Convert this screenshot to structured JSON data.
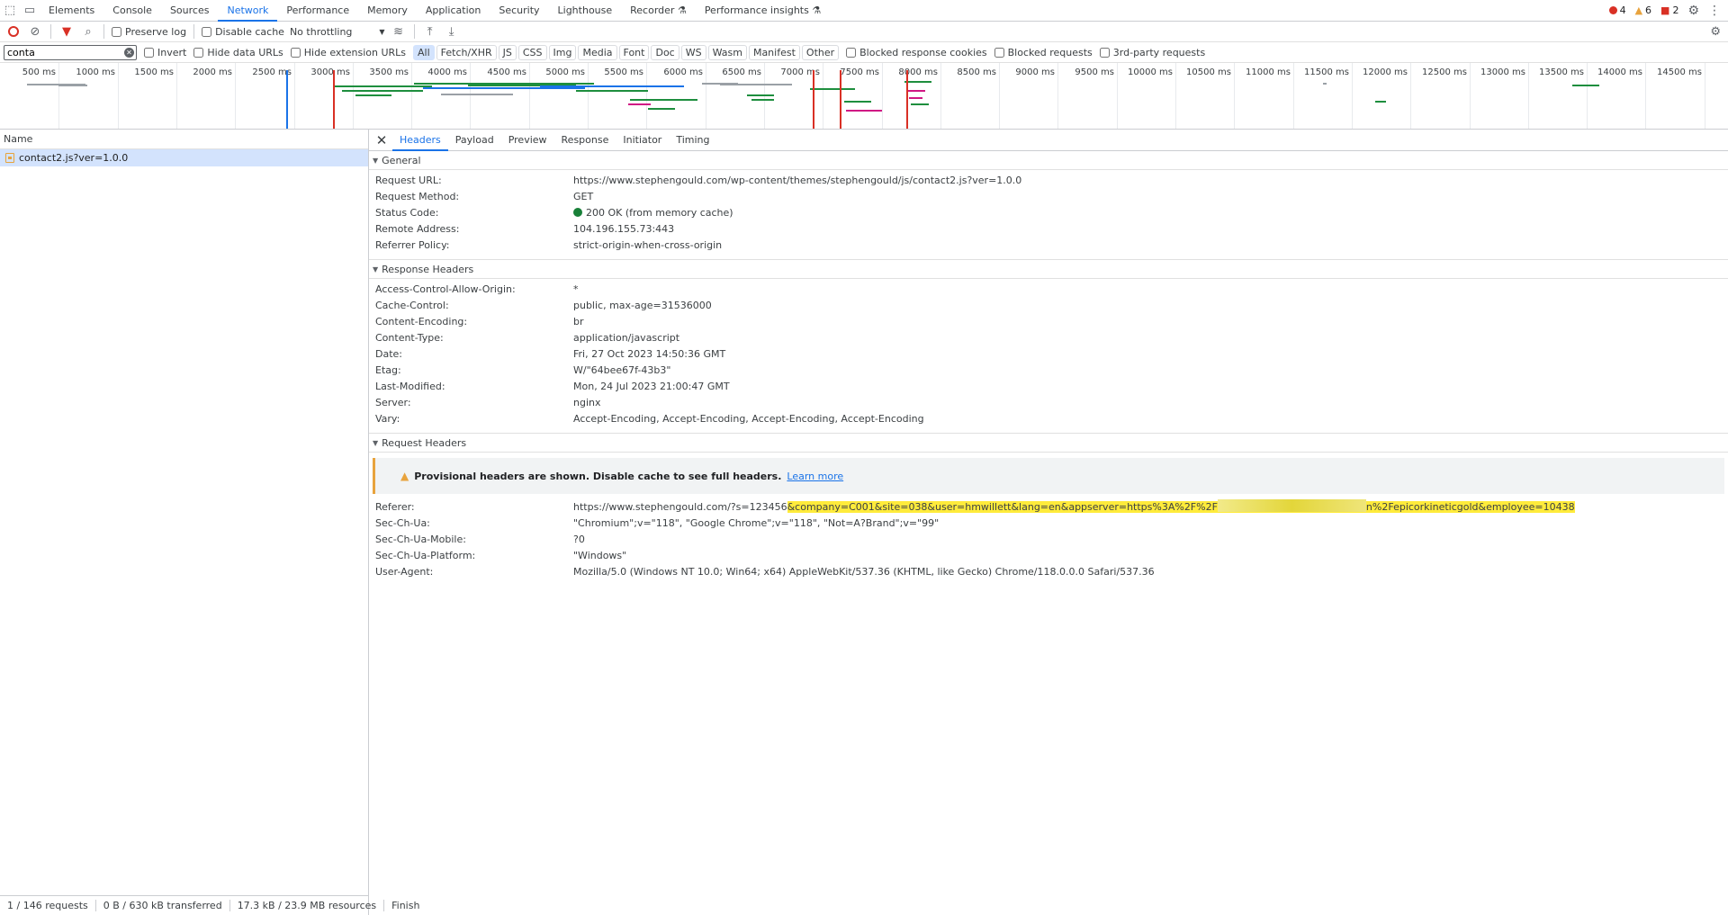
{
  "devtools": {
    "tabs": [
      "Elements",
      "Console",
      "Sources",
      "Network",
      "Performance",
      "Memory",
      "Application",
      "Security",
      "Lighthouse",
      "Recorder",
      "Performance insights"
    ],
    "active_tab": "Network",
    "counts": {
      "errors": "4",
      "warnings": "6",
      "issues": "2"
    }
  },
  "toolbar": {
    "preserve_log": "Preserve log",
    "disable_cache": "Disable cache",
    "throttling": "No throttling"
  },
  "filter": {
    "value": "conta",
    "invert": "Invert",
    "hide_data_urls": "Hide data URLs",
    "hide_extension_urls": "Hide extension URLs",
    "types": [
      "All",
      "Fetch/XHR",
      "JS",
      "CSS",
      "Img",
      "Media",
      "Font",
      "Doc",
      "WS",
      "Wasm",
      "Manifest",
      "Other"
    ],
    "blocked_response_cookies": "Blocked response cookies",
    "blocked_requests": "Blocked requests",
    "third_party": "3rd-party requests"
  },
  "overview": {
    "ticks": [
      "500 ms",
      "1000 ms",
      "1500 ms",
      "2000 ms",
      "2500 ms",
      "3000 ms",
      "3500 ms",
      "4000 ms",
      "4500 ms",
      "5000 ms",
      "5500 ms",
      "6000 ms",
      "6500 ms",
      "7000 ms",
      "7500 ms",
      "8000 ms",
      "8500 ms",
      "9000 ms",
      "9500 ms",
      "10000 ms",
      "10500 ms",
      "11000 ms",
      "11500 ms",
      "12000 ms",
      "12500 ms",
      "13000 ms",
      "13500 ms",
      "14000 ms",
      "14500 ms"
    ]
  },
  "list": {
    "header": "Name",
    "rows": [
      "contact2.js?ver=1.0.0"
    ]
  },
  "status": {
    "requests": "1 / 146 requests",
    "transferred": "0 B / 630 kB transferred",
    "resources": "17.3 kB / 23.9 MB resources",
    "finish": "Finish"
  },
  "detail": {
    "tabs": [
      "Headers",
      "Payload",
      "Preview",
      "Response",
      "Initiator",
      "Timing"
    ],
    "general": {
      "title": "General",
      "rows": [
        {
          "k": "Request URL:",
          "v": "https://www.stephengould.com/wp-content/themes/stephengould/js/contact2.js?ver=1.0.0"
        },
        {
          "k": "Request Method:",
          "v": "GET"
        },
        {
          "k": "Status Code:",
          "v": "200 OK (from memory cache)"
        },
        {
          "k": "Remote Address:",
          "v": "104.196.155.73:443"
        },
        {
          "k": "Referrer Policy:",
          "v": "strict-origin-when-cross-origin"
        }
      ]
    },
    "response": {
      "title": "Response Headers",
      "rows": [
        {
          "k": "Access-Control-Allow-Origin:",
          "v": "*"
        },
        {
          "k": "Cache-Control:",
          "v": "public, max-age=31536000"
        },
        {
          "k": "Content-Encoding:",
          "v": "br"
        },
        {
          "k": "Content-Type:",
          "v": "application/javascript"
        },
        {
          "k": "Date:",
          "v": "Fri, 27 Oct 2023 14:50:36 GMT"
        },
        {
          "k": "Etag:",
          "v": "W/\"64bee67f-43b3\""
        },
        {
          "k": "Last-Modified:",
          "v": "Mon, 24 Jul 2023 21:00:47 GMT"
        },
        {
          "k": "Server:",
          "v": "nginx"
        },
        {
          "k": "Vary:",
          "v": "Accept-Encoding, Accept-Encoding, Accept-Encoding, Accept-Encoding"
        }
      ]
    },
    "request": {
      "title": "Request Headers",
      "warning": "Provisional headers are shown. Disable cache to see full headers.",
      "learn_more": "Learn more",
      "referer_key": "Referer:",
      "referer_prefix": "https://www.stephengould.com/?s=123456",
      "referer_highlight": "&company=C001&site=038&user=hmwillett&lang=en&appserver=https%3A%2F%2F",
      "referer_suffix": "n%2Fepicorkineticgold&employee=10438",
      "rows": [
        {
          "k": "Sec-Ch-Ua:",
          "v": "\"Chromium\";v=\"118\", \"Google Chrome\";v=\"118\", \"Not=A?Brand\";v=\"99\""
        },
        {
          "k": "Sec-Ch-Ua-Mobile:",
          "v": "?0"
        },
        {
          "k": "Sec-Ch-Ua-Platform:",
          "v": "\"Windows\""
        },
        {
          "k": "User-Agent:",
          "v": "Mozilla/5.0 (Windows NT 10.0; Win64; x64) AppleWebKit/537.36 (KHTML, like Gecko) Chrome/118.0.0.0 Safari/537.36"
        }
      ]
    }
  }
}
